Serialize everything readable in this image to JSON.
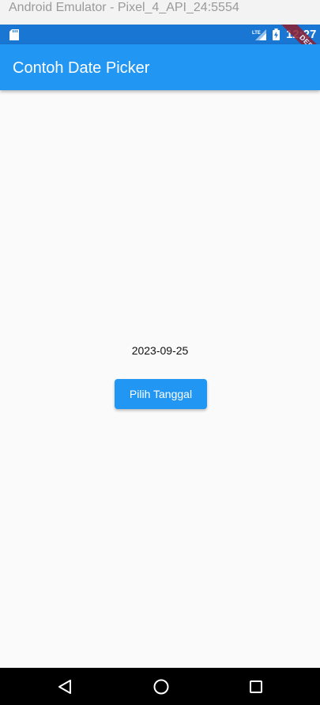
{
  "window": {
    "title": "Android Emulator - Pixel_4_API_24:5554"
  },
  "status_bar": {
    "time": "12:27",
    "lte_label": "LTE",
    "icons": [
      "sd-card-icon",
      "lte-signal-icon",
      "battery-charging-icon"
    ],
    "color": "#1976d2"
  },
  "debug_banner": {
    "label": "DEBUG",
    "color": "#8e2031"
  },
  "app_bar": {
    "title": "Contoh Date Picker",
    "color": "#2196f3"
  },
  "main": {
    "selected_date": "2023-09-25",
    "pick_button_label": "Pilih Tanggal"
  },
  "nav_bar": {
    "icons": [
      "back-icon",
      "home-icon",
      "recents-icon"
    ]
  }
}
